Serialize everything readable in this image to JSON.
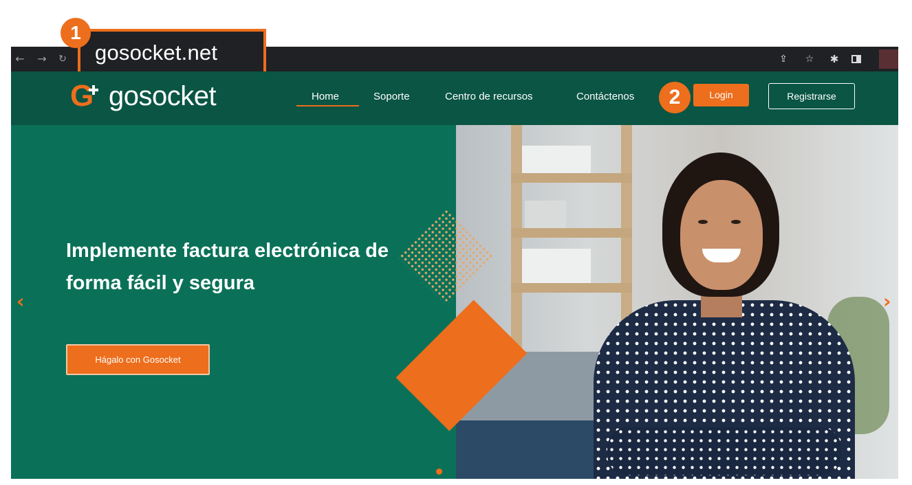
{
  "browser": {
    "url": "gosocket.net",
    "icons": {
      "back": "arrow-left-icon",
      "forward": "arrow-right-icon",
      "reload": "reload-icon",
      "share": "share-icon",
      "bookmark": "star-icon",
      "extensions": "puzzle-icon",
      "side_panel": "side-panel-icon"
    }
  },
  "annotations": {
    "step1": "1",
    "step2": "2"
  },
  "header": {
    "logo_text": "gosocket",
    "nav": {
      "home": "Home",
      "soporte": "Soporte",
      "recursos": "Centro de recursos",
      "contacto": "Contáctenos"
    },
    "login_label": "Login",
    "register_label": "Registrarse"
  },
  "hero": {
    "title": "Implemente factura electrónica de forma fácil y segura",
    "cta_label": "Hágalo con Gosocket"
  },
  "colors": {
    "brand_green": "#0a5544",
    "hero_green": "#0a7158",
    "accent_orange": "#ed6e1c"
  }
}
